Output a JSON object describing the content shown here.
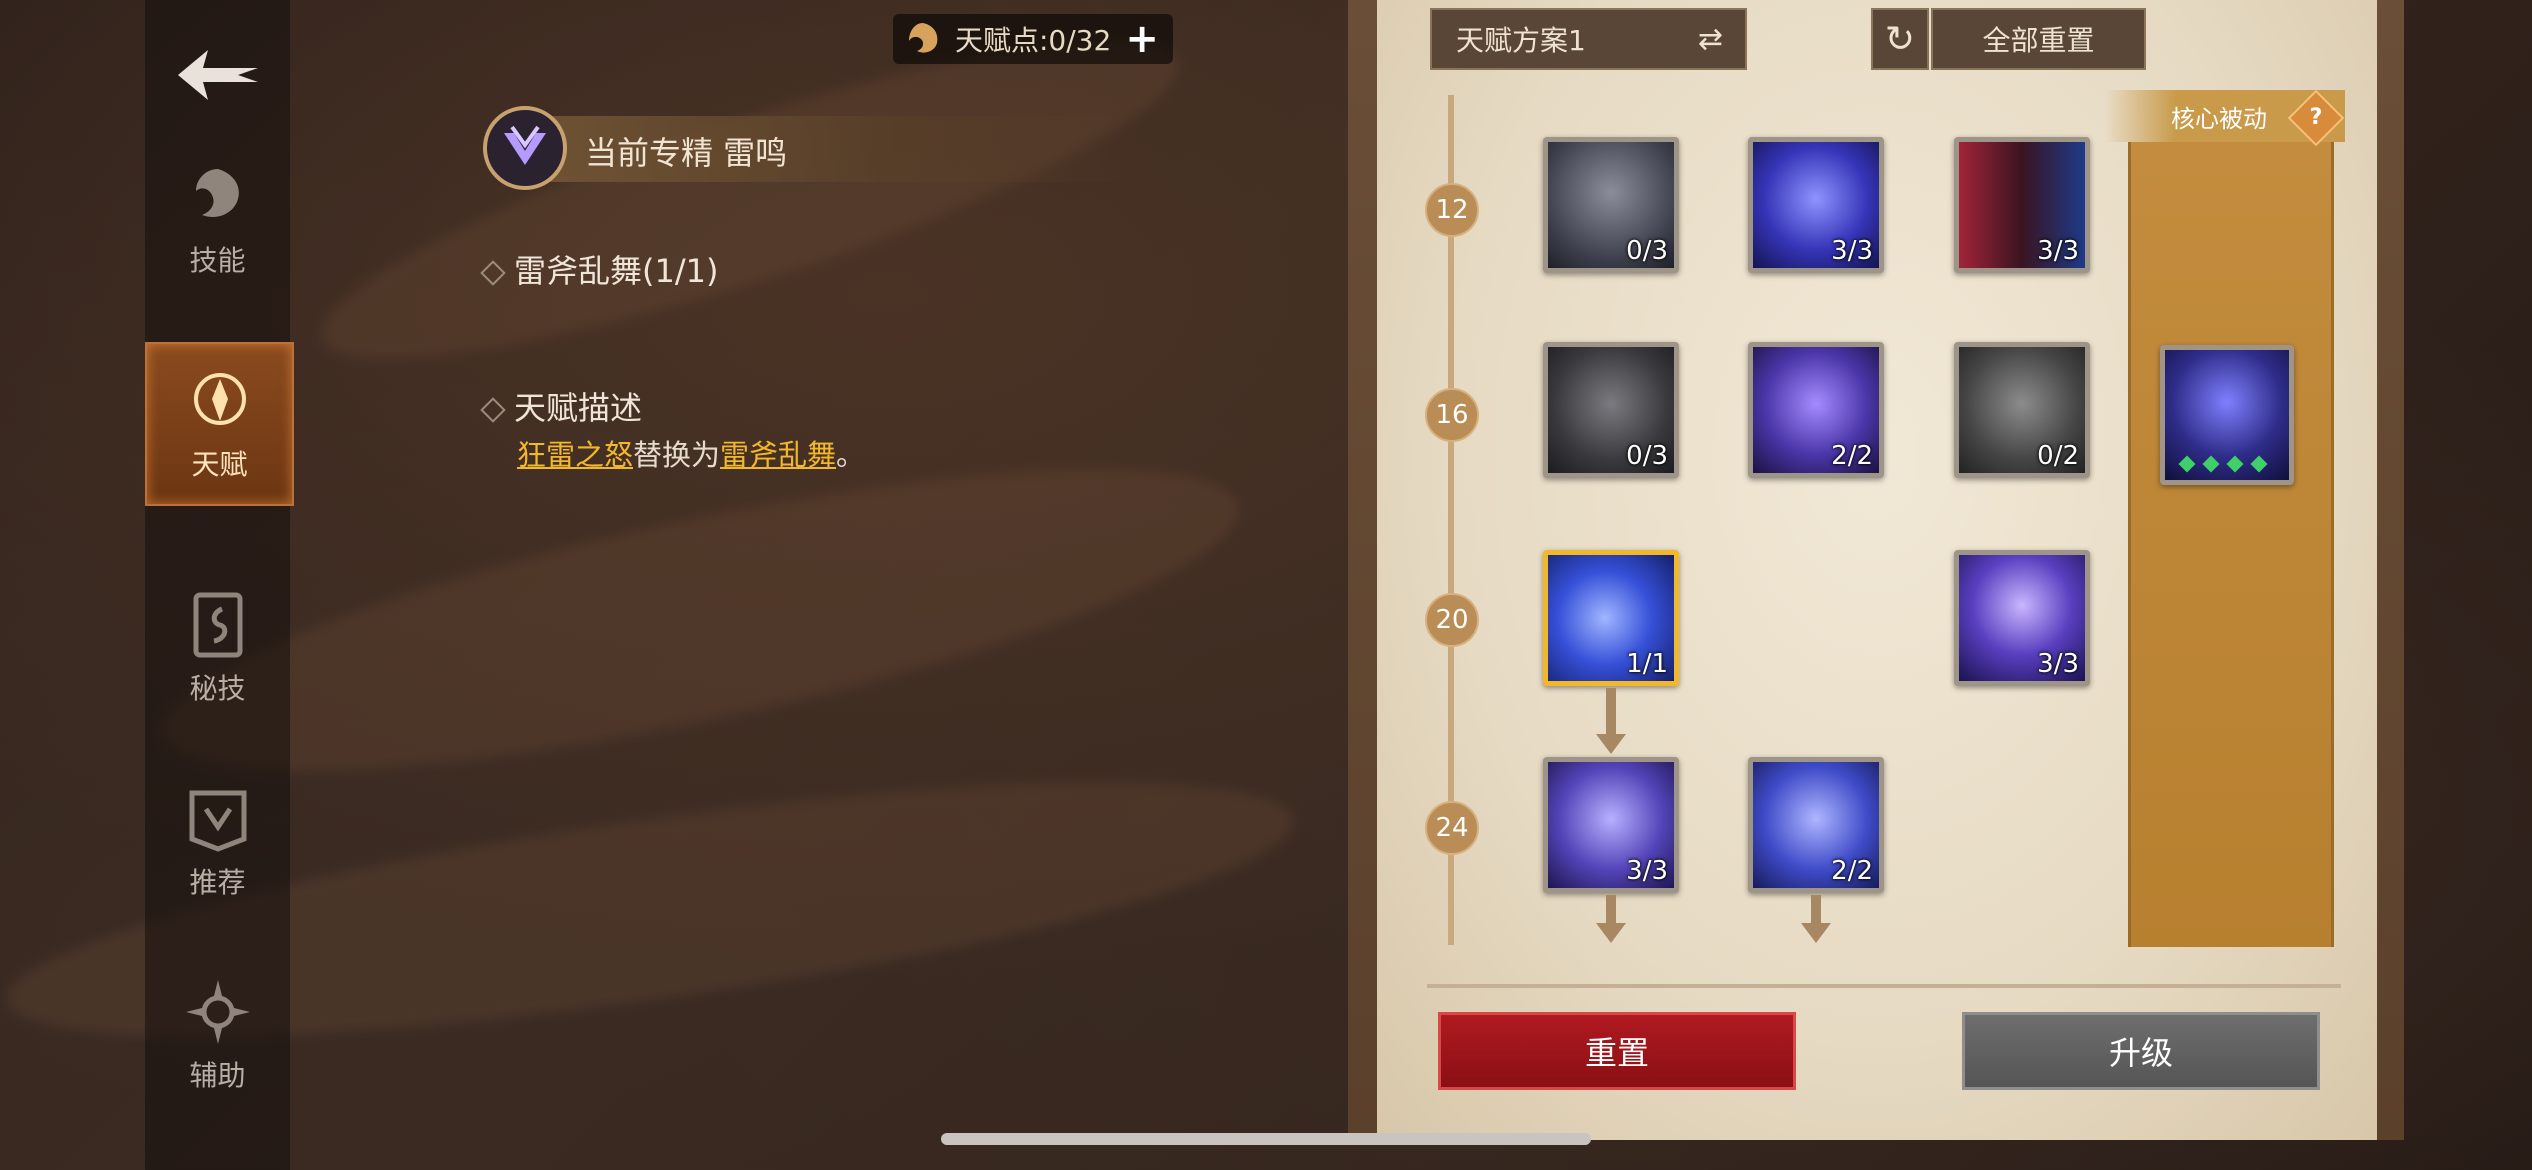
{
  "talent_points": {
    "label": "天赋点:0/32",
    "add": "+"
  },
  "nav": [
    {
      "label": "技能",
      "icon": "skill-icon"
    },
    {
      "label": "天赋",
      "icon": "talent-icon",
      "active": true
    },
    {
      "label": "秘技",
      "icon": "secret-skill-icon"
    },
    {
      "label": "推荐",
      "icon": "recommend-icon"
    },
    {
      "label": "辅助",
      "icon": "assist-icon"
    }
  ],
  "spec": {
    "title": "当前专精 雷鸣"
  },
  "selected_talent": {
    "name": "雷斧乱舞(1/1)"
  },
  "description": {
    "heading": "天赋描述",
    "part1": "狂雷之怒",
    "part2": "替换为",
    "part3": "雷斧乱舞",
    "part4": "。"
  },
  "panel": {
    "plan_label": "天赋方案1",
    "reset_all_label": "全部重置",
    "core_label": "核心被动",
    "core_help": "?"
  },
  "levels": [
    "12",
    "16",
    "20",
    "24"
  ],
  "nodes": [
    {
      "rank": "0/3"
    },
    {
      "rank": "3/3"
    },
    {
      "rank": "3/3"
    },
    {
      "rank": "0/3"
    },
    {
      "rank": "2/2"
    },
    {
      "rank": "0/2"
    },
    {
      "rank": "1/1"
    },
    {
      "rank": "3/3"
    },
    {
      "rank": "3/3"
    },
    {
      "rank": "2/2"
    }
  ],
  "core_passive_gems": 4,
  "buttons": {
    "reset": "重置",
    "upgrade": "升级"
  },
  "colors": {
    "accent": "#f2b82c",
    "reset": "#b01a20",
    "core": "#c38c3e"
  }
}
